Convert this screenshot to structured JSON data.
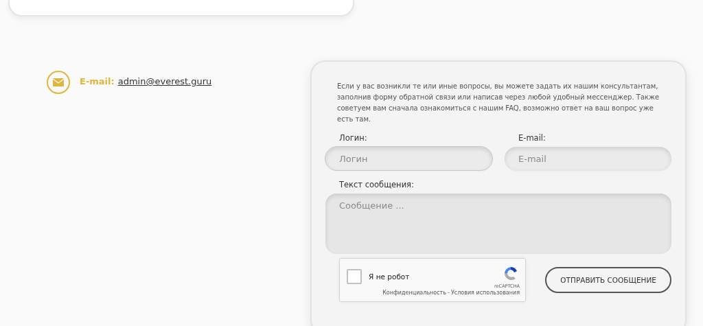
{
  "contact": {
    "label": "E-mail:",
    "value": "admin@everest.guru"
  },
  "form": {
    "intro": "Если у вас возникли те или иные вопросы, вы можете задать их нашим консультантам, заполнив форму обратной связи или написав через любой удобный мессенджер. Также советуем вам сначала ознакомиться с нашим FAQ, возможно ответ на ваш вопрос уже есть там.",
    "fields": [
      {
        "label": "Логин:",
        "placeholder": "Логин",
        "focused": true
      },
      {
        "label": "E-mail:",
        "placeholder": "E-mail",
        "focused": false
      }
    ],
    "message": {
      "label": "Текст сообщения:",
      "placeholder": "Сообщение ..."
    },
    "captcha": {
      "label": "Я не робот",
      "checked": false,
      "brand": "reCAPTCHA",
      "privacy": "Конфиденциальность",
      "separator": "-",
      "terms": "Условия использования"
    },
    "submit": "ОТПРАВИТЬ СООБЩЕНИЕ"
  }
}
